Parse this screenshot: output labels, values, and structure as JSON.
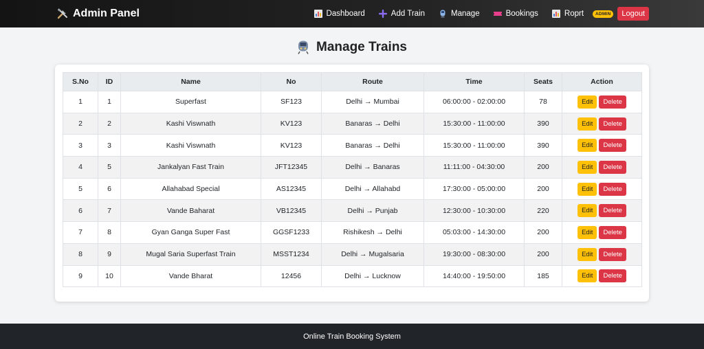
{
  "navbar": {
    "brand": "Admin Panel",
    "links": [
      {
        "label": "Dashboard",
        "icon": "bar-chart-icon"
      },
      {
        "label": "Add Train",
        "icon": "plus-icon"
      },
      {
        "label": "Manage",
        "icon": "train-icon"
      },
      {
        "label": "Bookings",
        "icon": "ticket-icon"
      },
      {
        "label": "Roprt",
        "icon": "bar-chart-icon"
      }
    ],
    "badge": "ADMIN",
    "logout_label": "Logout"
  },
  "page": {
    "title": "Manage Trains"
  },
  "table": {
    "headers": [
      "S.No",
      "ID",
      "Name",
      "No",
      "Route",
      "Time",
      "Seats",
      "Action"
    ],
    "edit_label": "Edit",
    "delete_label": "Delete",
    "rows": [
      {
        "sno": "1",
        "id": "1",
        "name": "Superfast",
        "no": "SF123",
        "route": "Delhi → Mumbai",
        "time": "06:00:00 - 02:00:00",
        "seats": "78"
      },
      {
        "sno": "2",
        "id": "2",
        "name": "Kashi Viswnath",
        "no": "KV123",
        "route": "Banaras → Delhi",
        "time": "15:30:00 - 11:00:00",
        "seats": "390"
      },
      {
        "sno": "3",
        "id": "3",
        "name": "Kashi Viswnath",
        "no": "KV123",
        "route": "Banaras → Delhi",
        "time": "15:30:00 - 11:00:00",
        "seats": "390"
      },
      {
        "sno": "4",
        "id": "5",
        "name": "Jankalyan Fast Train",
        "no": "JFT12345",
        "route": "Delhi → Banaras",
        "time": "11:11:00 - 04:30:00",
        "seats": "200"
      },
      {
        "sno": "5",
        "id": "6",
        "name": "Allahabad Special",
        "no": "AS12345",
        "route": "Delhi → Allahabd",
        "time": "17:30:00 - 05:00:00",
        "seats": "200"
      },
      {
        "sno": "6",
        "id": "7",
        "name": "Vande Baharat",
        "no": "VB12345",
        "route": "Delhi → Punjab",
        "time": "12:30:00 - 10:30:00",
        "seats": "220"
      },
      {
        "sno": "7",
        "id": "8",
        "name": "Gyan Ganga Super Fast",
        "no": "GGSF1233",
        "route": "Rishikesh → Delhi",
        "time": "05:03:00 - 14:30:00",
        "seats": "200"
      },
      {
        "sno": "8",
        "id": "9",
        "name": "Mugal Saria Superfast Train",
        "no": "MSST1234",
        "route": "Delhi → Mugalsaria",
        "time": "19:30:00 - 08:30:00",
        "seats": "200"
      },
      {
        "sno": "9",
        "id": "10",
        "name": "Vande Bharat",
        "no": "12456",
        "route": "Delhi → Lucknow",
        "time": "14:40:00 - 19:50:00",
        "seats": "185"
      }
    ]
  },
  "footer": {
    "text": "Online Train Booking System"
  },
  "colors": {
    "edit": "#ffc107",
    "delete": "#dc3545",
    "navbar": "#1a1a1a",
    "footer": "#212529"
  }
}
